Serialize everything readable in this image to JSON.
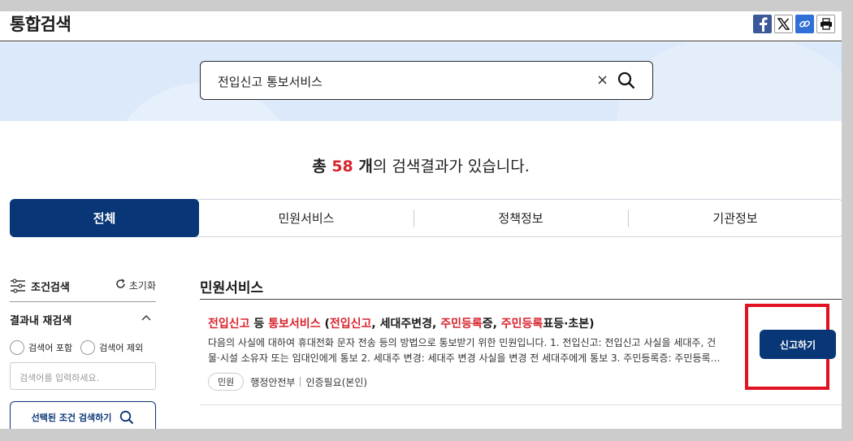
{
  "header": {
    "title": "통합검색"
  },
  "search": {
    "query": "전입신고 통보서비스",
    "clear": "×"
  },
  "summary": {
    "prefix": "총 ",
    "count": "58",
    "suffix_bold": " 개",
    "suffix": "의 검색결과가 있습니다."
  },
  "tabs": [
    {
      "label": "전체",
      "active": true
    },
    {
      "label": "민원서비스",
      "active": false
    },
    {
      "label": "정책정보",
      "active": false
    },
    {
      "label": "기관정보",
      "active": false
    }
  ],
  "filter": {
    "title": "조건검색",
    "reset": "초기화",
    "within_title": "결과내 재검색",
    "radio_include": "검색어 포함",
    "radio_exclude": "검색어 제외",
    "placeholder": "검색어를 입력하세요.",
    "apply": "선택된 조건 검색하기"
  },
  "results_section": {
    "title": "민원서비스",
    "items": [
      {
        "title_parts": [
          {
            "text": "전입신고",
            "hl": true
          },
          {
            "text": " 등 ",
            "hl": false
          },
          {
            "text": "통보서비스",
            "hl": true
          },
          {
            "text": " (",
            "hl": false
          },
          {
            "text": "전입신고",
            "hl": true
          },
          {
            "text": ", 세대주변경, ",
            "hl": false
          },
          {
            "text": "주민등록",
            "hl": true
          },
          {
            "text": "증, ",
            "hl": false
          },
          {
            "text": "주민등록",
            "hl": true
          },
          {
            "text": "표등·초본)",
            "hl": false
          }
        ],
        "desc_line1": "다음의 사실에 대하여 휴대전화 문자 전송 등의 방법으로 통보받기 위한 민원입니다. 1. 전입신고: 전입신고 사실을 세대주, 건",
        "desc_line2": "물·시설 소유자 또는 임대인에게 통보 2. 세대주 변경: 세대주 변경 사실을 변경 전 세대주에게 통보 3. 주민등록증: 주민등록…",
        "badge": "민원",
        "agency": "행정안전부",
        "auth": "인증필요(본인)",
        "action": "신고하기"
      }
    ]
  },
  "colors": {
    "primary": "#083676",
    "highlight": "#d9232d",
    "band": "#dbe9fb",
    "callout": "#e0121f"
  }
}
